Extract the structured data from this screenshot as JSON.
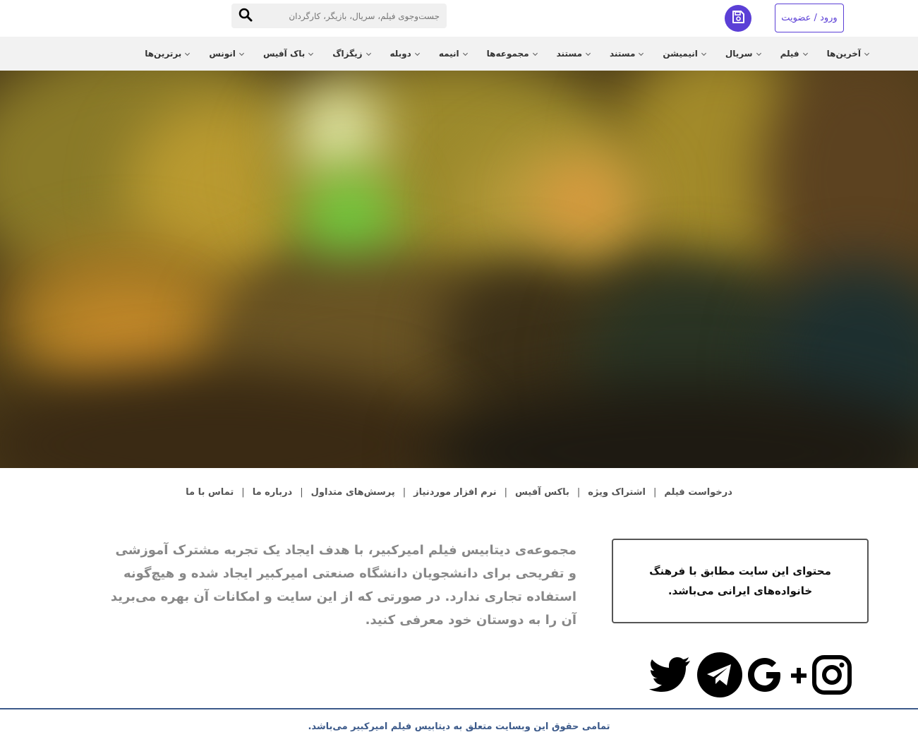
{
  "header": {
    "login_label": "ورود / عضویت",
    "search_placeholder": "جست‌وجوی فیلم، سریال، بازیگر، کارگردان",
    "accent_color": "#5b3fd6"
  },
  "nav": {
    "items": [
      {
        "label": "آخرین‌ها"
      },
      {
        "label": "فیلم"
      },
      {
        "label": "سریال"
      },
      {
        "label": "انیمیشن"
      },
      {
        "label": "مستند"
      },
      {
        "label": "مستند"
      },
      {
        "label": "مجموعه‌ها"
      },
      {
        "label": "انیمه"
      },
      {
        "label": "دوبله"
      },
      {
        "label": "زیگزاگ"
      },
      {
        "label": "باک آفیس"
      },
      {
        "label": "انونس"
      },
      {
        "label": "برترین‌ها"
      }
    ]
  },
  "footer_links": [
    "درخواست فیلم",
    "اشتراک ویژه",
    "باکس آفیس",
    "نرم افزار موردنیاز",
    "پرسش‌های متداول",
    "درباره ما",
    "تماس با ما"
  ],
  "notice": {
    "text": "محتوای این سایت مطابق با فرهنگ خانواده‌های ایرانی می‌باشد."
  },
  "about": {
    "text": "مجموعه‌ی دیتابیس فیلم امیرکبیر، با هدف ایجاد یک تجربه مشترک آموزشی و تفریحی برای دانشجویان دانشگاه صنعتی امیرکبیر ایجاد شده و هیچ‌گونه استفاده تجاری ندارد.  در صورتی که از این سایت و امکانات آن بهره می‌برید آن را به دوستان خود معرفی کنید."
  },
  "social": {
    "icons": [
      "instagram-icon",
      "google-plus-icon",
      "telegram-icon",
      "twitter-icon"
    ]
  },
  "copyright": "تمامی حقوق این وبسایت متعلق به دیتابیس فیلم امیرکبیر می‌باشد."
}
